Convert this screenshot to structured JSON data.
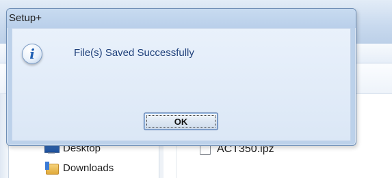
{
  "dialog": {
    "title": "Setup+",
    "icon": "information-icon",
    "icon_glyph": "i",
    "message": "File(s) Saved Successfully",
    "ok_label": "OK"
  },
  "background": {
    "nav_items": [
      {
        "label": "Desktop",
        "icon": "desktop-icon"
      },
      {
        "label": "Downloads",
        "icon": "downloads-folder-icon"
      }
    ],
    "files": [
      {
        "name": "ACT350.ipz",
        "checked": false
      }
    ]
  },
  "colors": {
    "dialog_frame": "#bcd1ea",
    "message_text": "#1e3f7a",
    "info_icon_accent": "#1f5fb3"
  }
}
